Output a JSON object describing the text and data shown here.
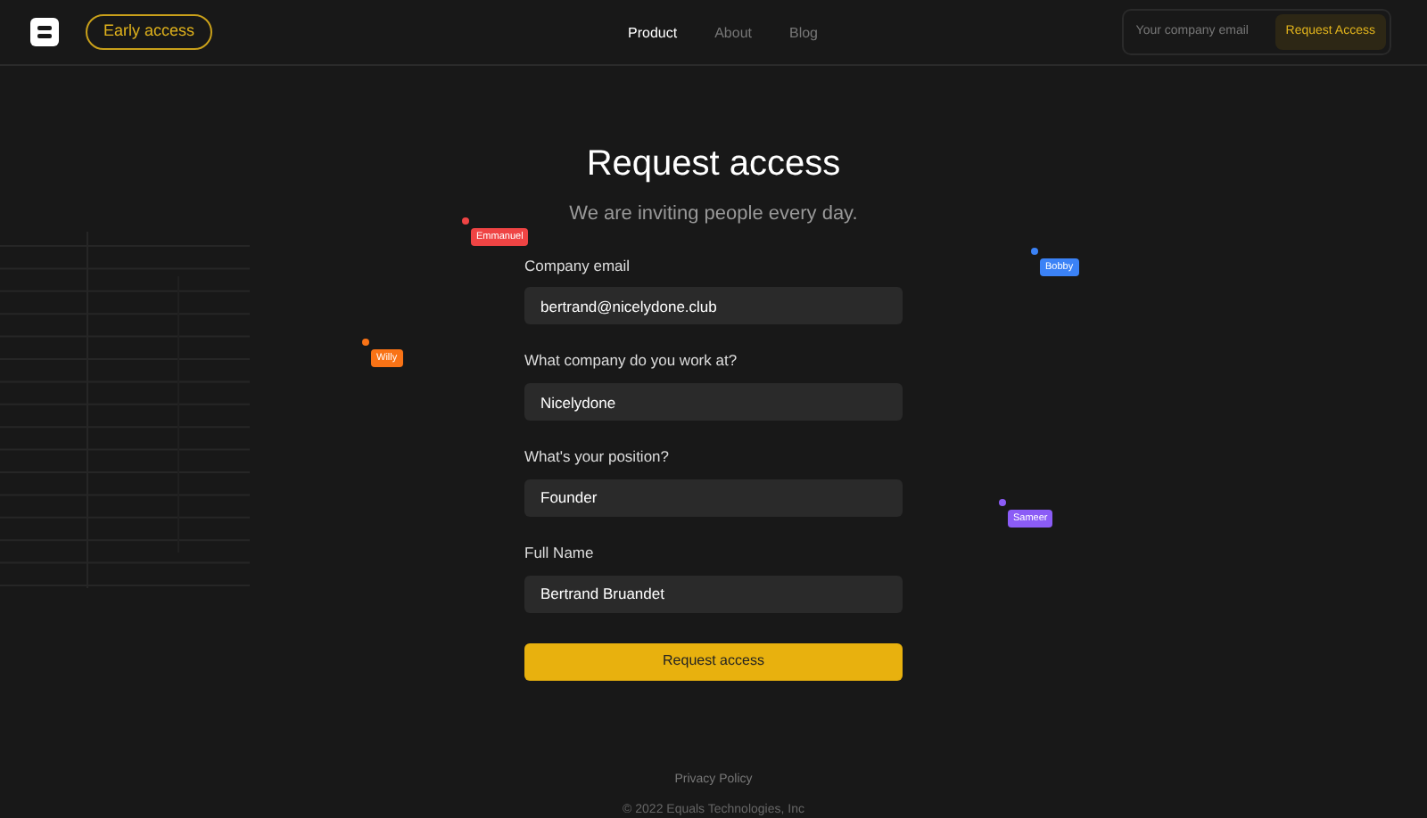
{
  "header": {
    "badge": "Early access",
    "nav": [
      {
        "label": "Product",
        "selected": true
      },
      {
        "label": "About",
        "selected": false
      },
      {
        "label": "Blog",
        "selected": false
      }
    ],
    "email_field": {
      "placeholder": "Your company email"
    },
    "button": "Request Access"
  },
  "title": "Request access",
  "subtitle": "We are inviting people every day.",
  "fields": [
    {
      "label": "Company email",
      "value": "bertrand@nicelydone.club"
    },
    {
      "label": "What company do you work at?",
      "value": "Nicelydone"
    },
    {
      "label": "What's your position?",
      "value": "Founder"
    },
    {
      "label": "Full Name",
      "value": "Bertrand Bruandet"
    }
  ],
  "submit": "Request access",
  "cursors": [
    {
      "name": "Emmanuel",
      "color": "#ef4444"
    },
    {
      "name": "Willy",
      "color": "#f97316"
    },
    {
      "name": "Bobby",
      "color": "#3b82f6"
    },
    {
      "name": "Sameer",
      "color": "#8b5cf6"
    }
  ],
  "footer": {
    "link": "Privacy Policy",
    "copyright": "© 2022 Equals Technologies, Inc"
  }
}
